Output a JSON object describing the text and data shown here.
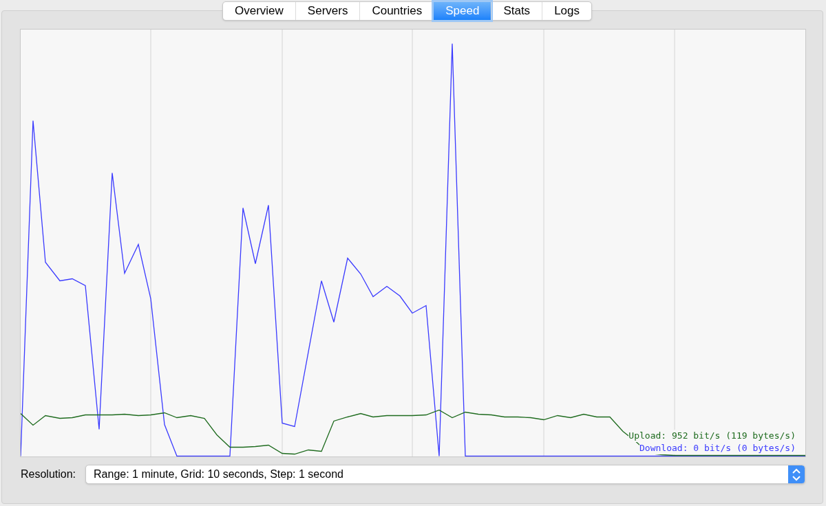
{
  "tabs": [
    {
      "label": "Overview",
      "selected": false
    },
    {
      "label": "Servers",
      "selected": false
    },
    {
      "label": "Countries",
      "selected": false
    },
    {
      "label": "Speed",
      "selected": true
    },
    {
      "label": "Stats",
      "selected": false
    },
    {
      "label": "Logs",
      "selected": false
    }
  ],
  "speed_graph": {
    "upload_label": "Upload: 952 bit/s (119 bytes/s)",
    "download_label": "Download: 0 bit/s (0 bytes/s)"
  },
  "resolution": {
    "label": "Resolution:",
    "value": "Range: 1 minute, Grid: 10 seconds, Step: 1 second"
  }
}
